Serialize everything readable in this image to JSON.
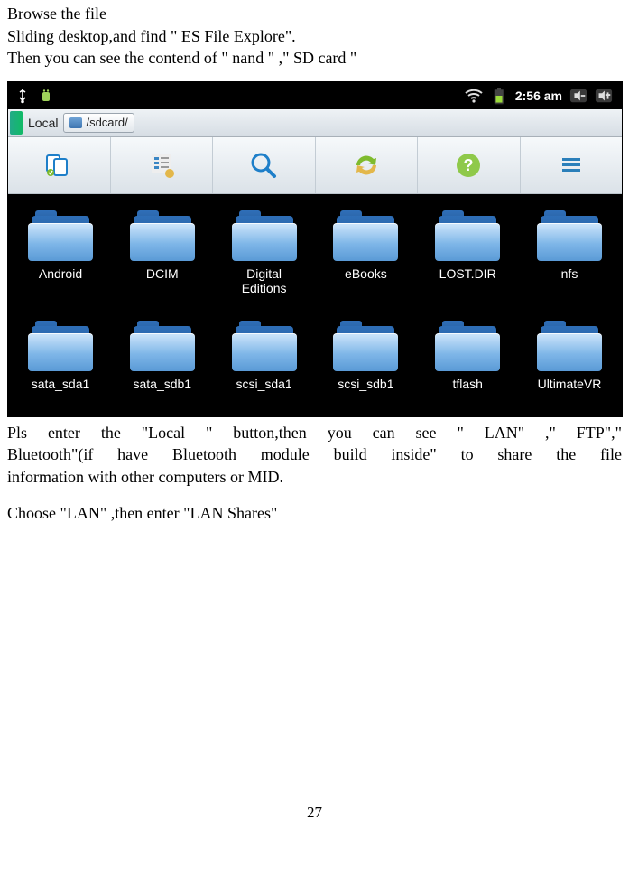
{
  "intro": {
    "l1": "Browse the file",
    "l2": "Sliding desktop,and find \" ES File Explore\".",
    "l3": "Then you can see the contend of   \" nand \" ,\" SD card \""
  },
  "statusbar": {
    "time": "2:56 am"
  },
  "pathbar": {
    "local": "Local",
    "path": "/sdcard/"
  },
  "toolbar": {
    "names": [
      "multiselect-icon",
      "view-icon",
      "search-icon",
      "refresh-icon",
      "help-icon",
      "menu-icon"
    ]
  },
  "folders": {
    "row1": [
      "Android",
      "DCIM",
      "Digital\nEditions",
      "eBooks",
      "LOST.DIR",
      "nfs"
    ],
    "row2": [
      "sata_sda1",
      "sata_sdb1",
      "scsi_sda1",
      "scsi_sdb1",
      "tflash",
      "UltimateVR"
    ]
  },
  "after": {
    "p1a": "Pls  enter  the  \"Local  \"  button,then    you  can  see  \"  LAN\"  ,\"  FTP\",\"",
    "p1b": "Bluetooth\"(if  have  Bluetooth  module  build  inside\"  to  share  the  file",
    "p1c": "information with other computers or MID.",
    "p2": "Choose \"LAN\" ,then enter \"LAN Shares\""
  },
  "page_number": "27"
}
